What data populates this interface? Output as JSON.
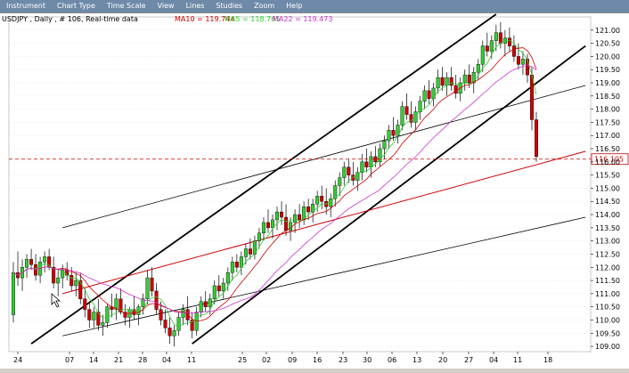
{
  "menu": {
    "items": [
      "Instrument",
      "Chart Type",
      "Time Scale",
      "View",
      "Lines",
      "Studies",
      "Zoom",
      "Help"
    ]
  },
  "chart_header": {
    "symbol": "USDJPY , Daily , # 106, Real-time data",
    "ma10": "MA10 = 119.744",
    "ma5": "MA5 = 118.765",
    "ma22": "MA22 = 119.473"
  },
  "colors": {
    "menubar": "#6e8aa8",
    "up_candle": "#33cc33",
    "down_candle": "#cc0000",
    "ma10": "#cc0000",
    "ma5": "#33cc33",
    "ma22": "#cc33cc",
    "current_price": "#cc0000",
    "trend": "#000000"
  },
  "chart_data": {
    "type": "candlestick",
    "ylim": [
      108.8,
      121.5
    ],
    "yticks": [
      "121.00",
      "120.50",
      "120.00",
      "119.50",
      "119.00",
      "118.50",
      "118.00",
      "117.50",
      "117.00",
      "116.50",
      "116.00",
      "115.50",
      "115.00",
      "114.50",
      "114.00",
      "113.50",
      "113.00",
      "112.50",
      "112.00",
      "111.50",
      "111.00",
      "110.50",
      "110.00",
      "109.50",
      "109.00"
    ],
    "xticks": [
      "24",
      "07",
      "14",
      "21",
      "28",
      "04",
      "11",
      "25",
      "02",
      "09",
      "16",
      "23",
      "30",
      "06",
      "13",
      "20",
      "27",
      "04",
      "11",
      "18"
    ],
    "current_price": 116.105,
    "current_price_label": "116.105",
    "candles": [
      [
        110.2,
        112.2,
        109.9,
        111.8
      ],
      [
        111.8,
        112.6,
        111.3,
        111.6
      ],
      [
        111.6,
        112.3,
        111.1,
        112.0
      ],
      [
        112.0,
        112.5,
        111.6,
        112.3
      ],
      [
        112.3,
        112.7,
        111.9,
        112.1
      ],
      [
        112.1,
        112.5,
        111.5,
        111.7
      ],
      [
        111.7,
        112.4,
        111.4,
        112.2
      ],
      [
        112.2,
        112.6,
        111.8,
        112.4
      ],
      [
        112.4,
        112.7,
        111.9,
        112.0
      ],
      [
        112.0,
        112.4,
        111.2,
        111.4
      ],
      [
        111.4,
        111.9,
        110.9,
        111.6
      ],
      [
        111.6,
        112.1,
        111.2,
        111.9
      ],
      [
        111.9,
        112.2,
        111.5,
        111.7
      ],
      [
        111.7,
        112.0,
        111.1,
        111.3
      ],
      [
        111.3,
        111.8,
        110.9,
        111.5
      ],
      [
        111.5,
        111.8,
        110.6,
        110.8
      ],
      [
        110.8,
        111.2,
        110.1,
        110.4
      ],
      [
        110.4,
        110.7,
        109.7,
        110.0
      ],
      [
        110.0,
        110.5,
        109.7,
        110.3
      ],
      [
        110.3,
        110.8,
        109.6,
        109.8
      ],
      [
        109.8,
        110.2,
        109.4,
        109.9
      ],
      [
        109.9,
        110.6,
        109.7,
        110.5
      ],
      [
        110.5,
        111.0,
        110.1,
        110.4
      ],
      [
        110.4,
        111.0,
        110.0,
        110.8
      ],
      [
        110.8,
        111.2,
        110.2,
        110.3
      ],
      [
        110.3,
        110.6,
        109.8,
        110.1
      ],
      [
        110.1,
        110.5,
        109.7,
        110.4
      ],
      [
        110.4,
        110.9,
        110.0,
        110.2
      ],
      [
        110.2,
        110.6,
        109.8,
        110.5
      ],
      [
        110.5,
        111.0,
        110.2,
        110.8
      ],
      [
        110.8,
        111.9,
        110.6,
        111.6
      ],
      [
        111.6,
        112.0,
        110.9,
        111.1
      ],
      [
        111.1,
        111.4,
        110.2,
        110.4
      ],
      [
        110.4,
        110.7,
        109.8,
        110.0
      ],
      [
        110.0,
        110.4,
        109.5,
        109.7
      ],
      [
        109.7,
        110.1,
        109.1,
        109.4
      ],
      [
        109.4,
        109.8,
        109.0,
        109.6
      ],
      [
        109.6,
        110.3,
        109.4,
        110.1
      ],
      [
        110.1,
        110.6,
        109.8,
        110.4
      ],
      [
        110.4,
        110.9,
        109.8,
        110.0
      ],
      [
        110.0,
        110.3,
        109.3,
        109.6
      ],
      [
        109.6,
        110.5,
        109.4,
        110.3
      ],
      [
        110.3,
        110.9,
        110.1,
        110.7
      ],
      [
        110.7,
        111.1,
        110.3,
        110.5
      ],
      [
        110.5,
        111.0,
        110.2,
        110.8
      ],
      [
        110.8,
        111.5,
        110.6,
        111.3
      ],
      [
        111.3,
        111.7,
        110.9,
        111.1
      ],
      [
        111.1,
        111.6,
        110.8,
        111.4
      ],
      [
        111.4,
        112.0,
        111.1,
        111.8
      ],
      [
        111.8,
        112.4,
        111.5,
        112.2
      ],
      [
        112.2,
        112.5,
        111.8,
        112.0
      ],
      [
        112.0,
        112.6,
        111.7,
        112.4
      ],
      [
        112.4,
        112.9,
        112.1,
        112.7
      ],
      [
        112.7,
        113.1,
        112.3,
        112.5
      ],
      [
        112.5,
        113.2,
        112.3,
        113.0
      ],
      [
        113.0,
        113.5,
        112.7,
        113.3
      ],
      [
        113.3,
        113.9,
        113.0,
        113.7
      ],
      [
        113.7,
        114.2,
        113.3,
        113.5
      ],
      [
        113.5,
        114.0,
        113.1,
        113.8
      ],
      [
        113.8,
        114.3,
        113.4,
        114.1
      ],
      [
        114.1,
        114.5,
        113.6,
        113.9
      ],
      [
        113.9,
        114.4,
        113.2,
        113.4
      ],
      [
        113.4,
        113.9,
        113.0,
        113.7
      ],
      [
        113.7,
        114.2,
        113.3,
        114.0
      ],
      [
        114.0,
        114.4,
        113.5,
        113.8
      ],
      [
        113.8,
        114.5,
        113.6,
        114.3
      ],
      [
        114.3,
        114.6,
        113.8,
        114.1
      ],
      [
        114.1,
        114.6,
        113.7,
        114.4
      ],
      [
        114.4,
        114.9,
        114.1,
        114.7
      ],
      [
        114.7,
        115.1,
        114.2,
        114.5
      ],
      [
        114.5,
        115.0,
        114.0,
        114.3
      ],
      [
        114.3,
        114.8,
        113.9,
        114.6
      ],
      [
        114.6,
        115.3,
        114.3,
        115.1
      ],
      [
        115.1,
        115.6,
        114.7,
        115.4
      ],
      [
        115.4,
        116.0,
        115.1,
        115.8
      ],
      [
        115.8,
        116.1,
        115.2,
        115.5
      ],
      [
        115.5,
        116.0,
        115.1,
        115.3
      ],
      [
        115.3,
        115.8,
        114.9,
        115.6
      ],
      [
        115.6,
        116.3,
        115.3,
        116.0
      ],
      [
        116.0,
        116.5,
        115.6,
        115.8
      ],
      [
        115.8,
        116.4,
        115.4,
        116.2
      ],
      [
        116.2,
        116.6,
        115.8,
        116.0
      ],
      [
        116.0,
        116.7,
        115.8,
        116.5
      ],
      [
        116.5,
        117.0,
        116.1,
        116.8
      ],
      [
        116.8,
        117.4,
        116.5,
        117.2
      ],
      [
        117.2,
        117.7,
        116.8,
        117.0
      ],
      [
        117.0,
        117.6,
        116.7,
        117.4
      ],
      [
        117.4,
        118.3,
        117.2,
        118.1
      ],
      [
        118.1,
        118.6,
        117.6,
        117.8
      ],
      [
        117.8,
        118.3,
        117.3,
        117.5
      ],
      [
        117.5,
        118.1,
        117.2,
        117.9
      ],
      [
        117.9,
        118.5,
        117.6,
        118.3
      ],
      [
        118.3,
        118.9,
        118.0,
        118.7
      ],
      [
        118.7,
        119.1,
        118.2,
        118.4
      ],
      [
        118.4,
        119.0,
        118.1,
        118.8
      ],
      [
        118.8,
        119.5,
        118.6,
        119.2
      ],
      [
        119.2,
        119.6,
        118.7,
        118.9
      ],
      [
        118.9,
        119.4,
        118.5,
        119.2
      ],
      [
        119.2,
        119.6,
        118.7,
        118.9
      ],
      [
        118.9,
        119.3,
        118.4,
        118.6
      ],
      [
        118.6,
        119.2,
        118.3,
        119.0
      ],
      [
        119.0,
        119.5,
        118.7,
        119.3
      ],
      [
        119.3,
        119.7,
        118.8,
        119.0
      ],
      [
        119.0,
        119.6,
        118.6,
        119.4
      ],
      [
        119.4,
        119.9,
        119.1,
        119.7
      ],
      [
        119.7,
        120.6,
        119.4,
        120.4
      ],
      [
        120.4,
        120.9,
        120.0,
        120.2
      ],
      [
        120.2,
        120.8,
        119.9,
        120.6
      ],
      [
        120.6,
        121.2,
        120.2,
        120.9
      ],
      [
        120.9,
        121.3,
        120.3,
        120.5
      ],
      [
        120.5,
        121.0,
        120.0,
        120.7
      ],
      [
        120.7,
        121.1,
        120.2,
        120.4
      ],
      [
        120.4,
        120.8,
        119.8,
        120.0
      ],
      [
        120.0,
        120.5,
        119.5,
        119.7
      ],
      [
        119.7,
        120.2,
        119.3,
        119.9
      ],
      [
        119.9,
        120.1,
        119.0,
        119.3
      ],
      [
        119.3,
        119.6,
        117.2,
        117.6
      ],
      [
        117.6,
        117.9,
        116.0,
        116.2
      ]
    ]
  }
}
